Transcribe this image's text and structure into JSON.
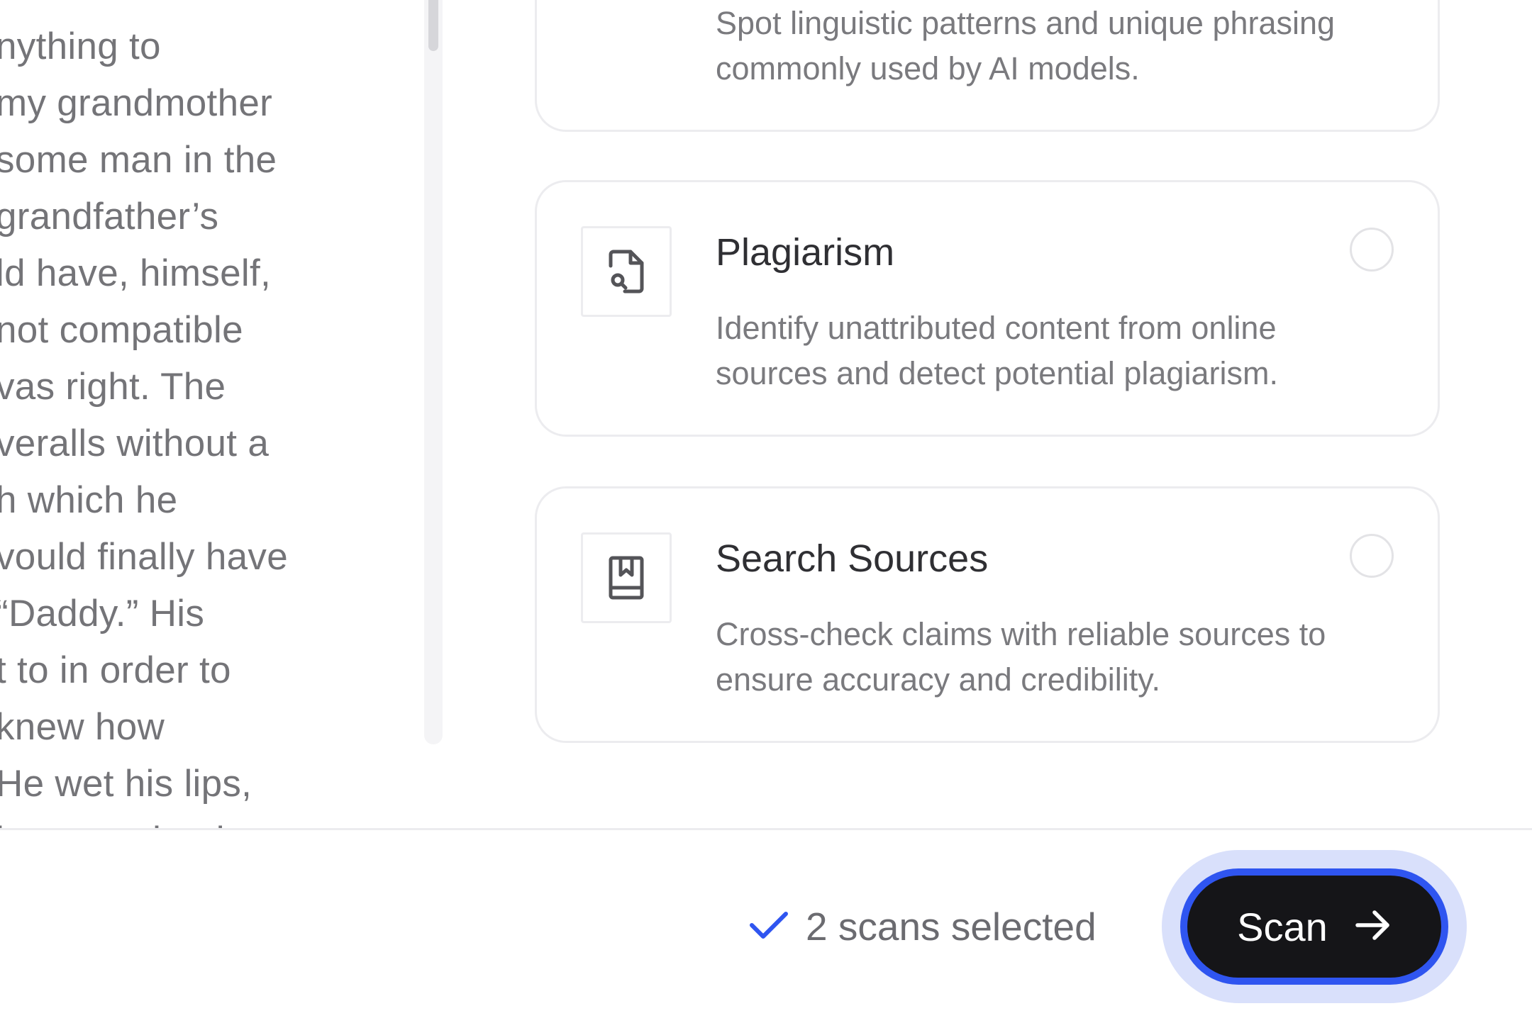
{
  "document": {
    "lines": [
      "nything to",
      "my grandmother",
      "some man in the",
      "grandfather’s",
      "ld have, himself,",
      "not compatible",
      "vas right. The",
      "veralls without a",
      "h which he",
      "vould finally have",
      "“Daddy.” His",
      "t to in order to",
      "knew how",
      "He wet his lips,",
      "he story that he"
    ]
  },
  "cards": [
    {
      "title": "",
      "description": "Spot linguistic patterns and unique phrasing commonly used by AI models.",
      "icon": "ai-pattern-icon"
    },
    {
      "title": "Plagiarism",
      "description": "Identify unattributed content from online sources and detect potential plagiarism.",
      "icon": "file-search-icon"
    },
    {
      "title": "Search Sources",
      "description": "Cross-check claims with reliable sources to ensure accuracy and credibility.",
      "icon": "bookmark-book-icon"
    }
  ],
  "footer": {
    "selected_text": "2 scans selected",
    "scan_label": "Scan"
  },
  "colors": {
    "accent": "#2F55F0",
    "button_bg": "#151518",
    "button_ring": "#D9E0FB"
  }
}
